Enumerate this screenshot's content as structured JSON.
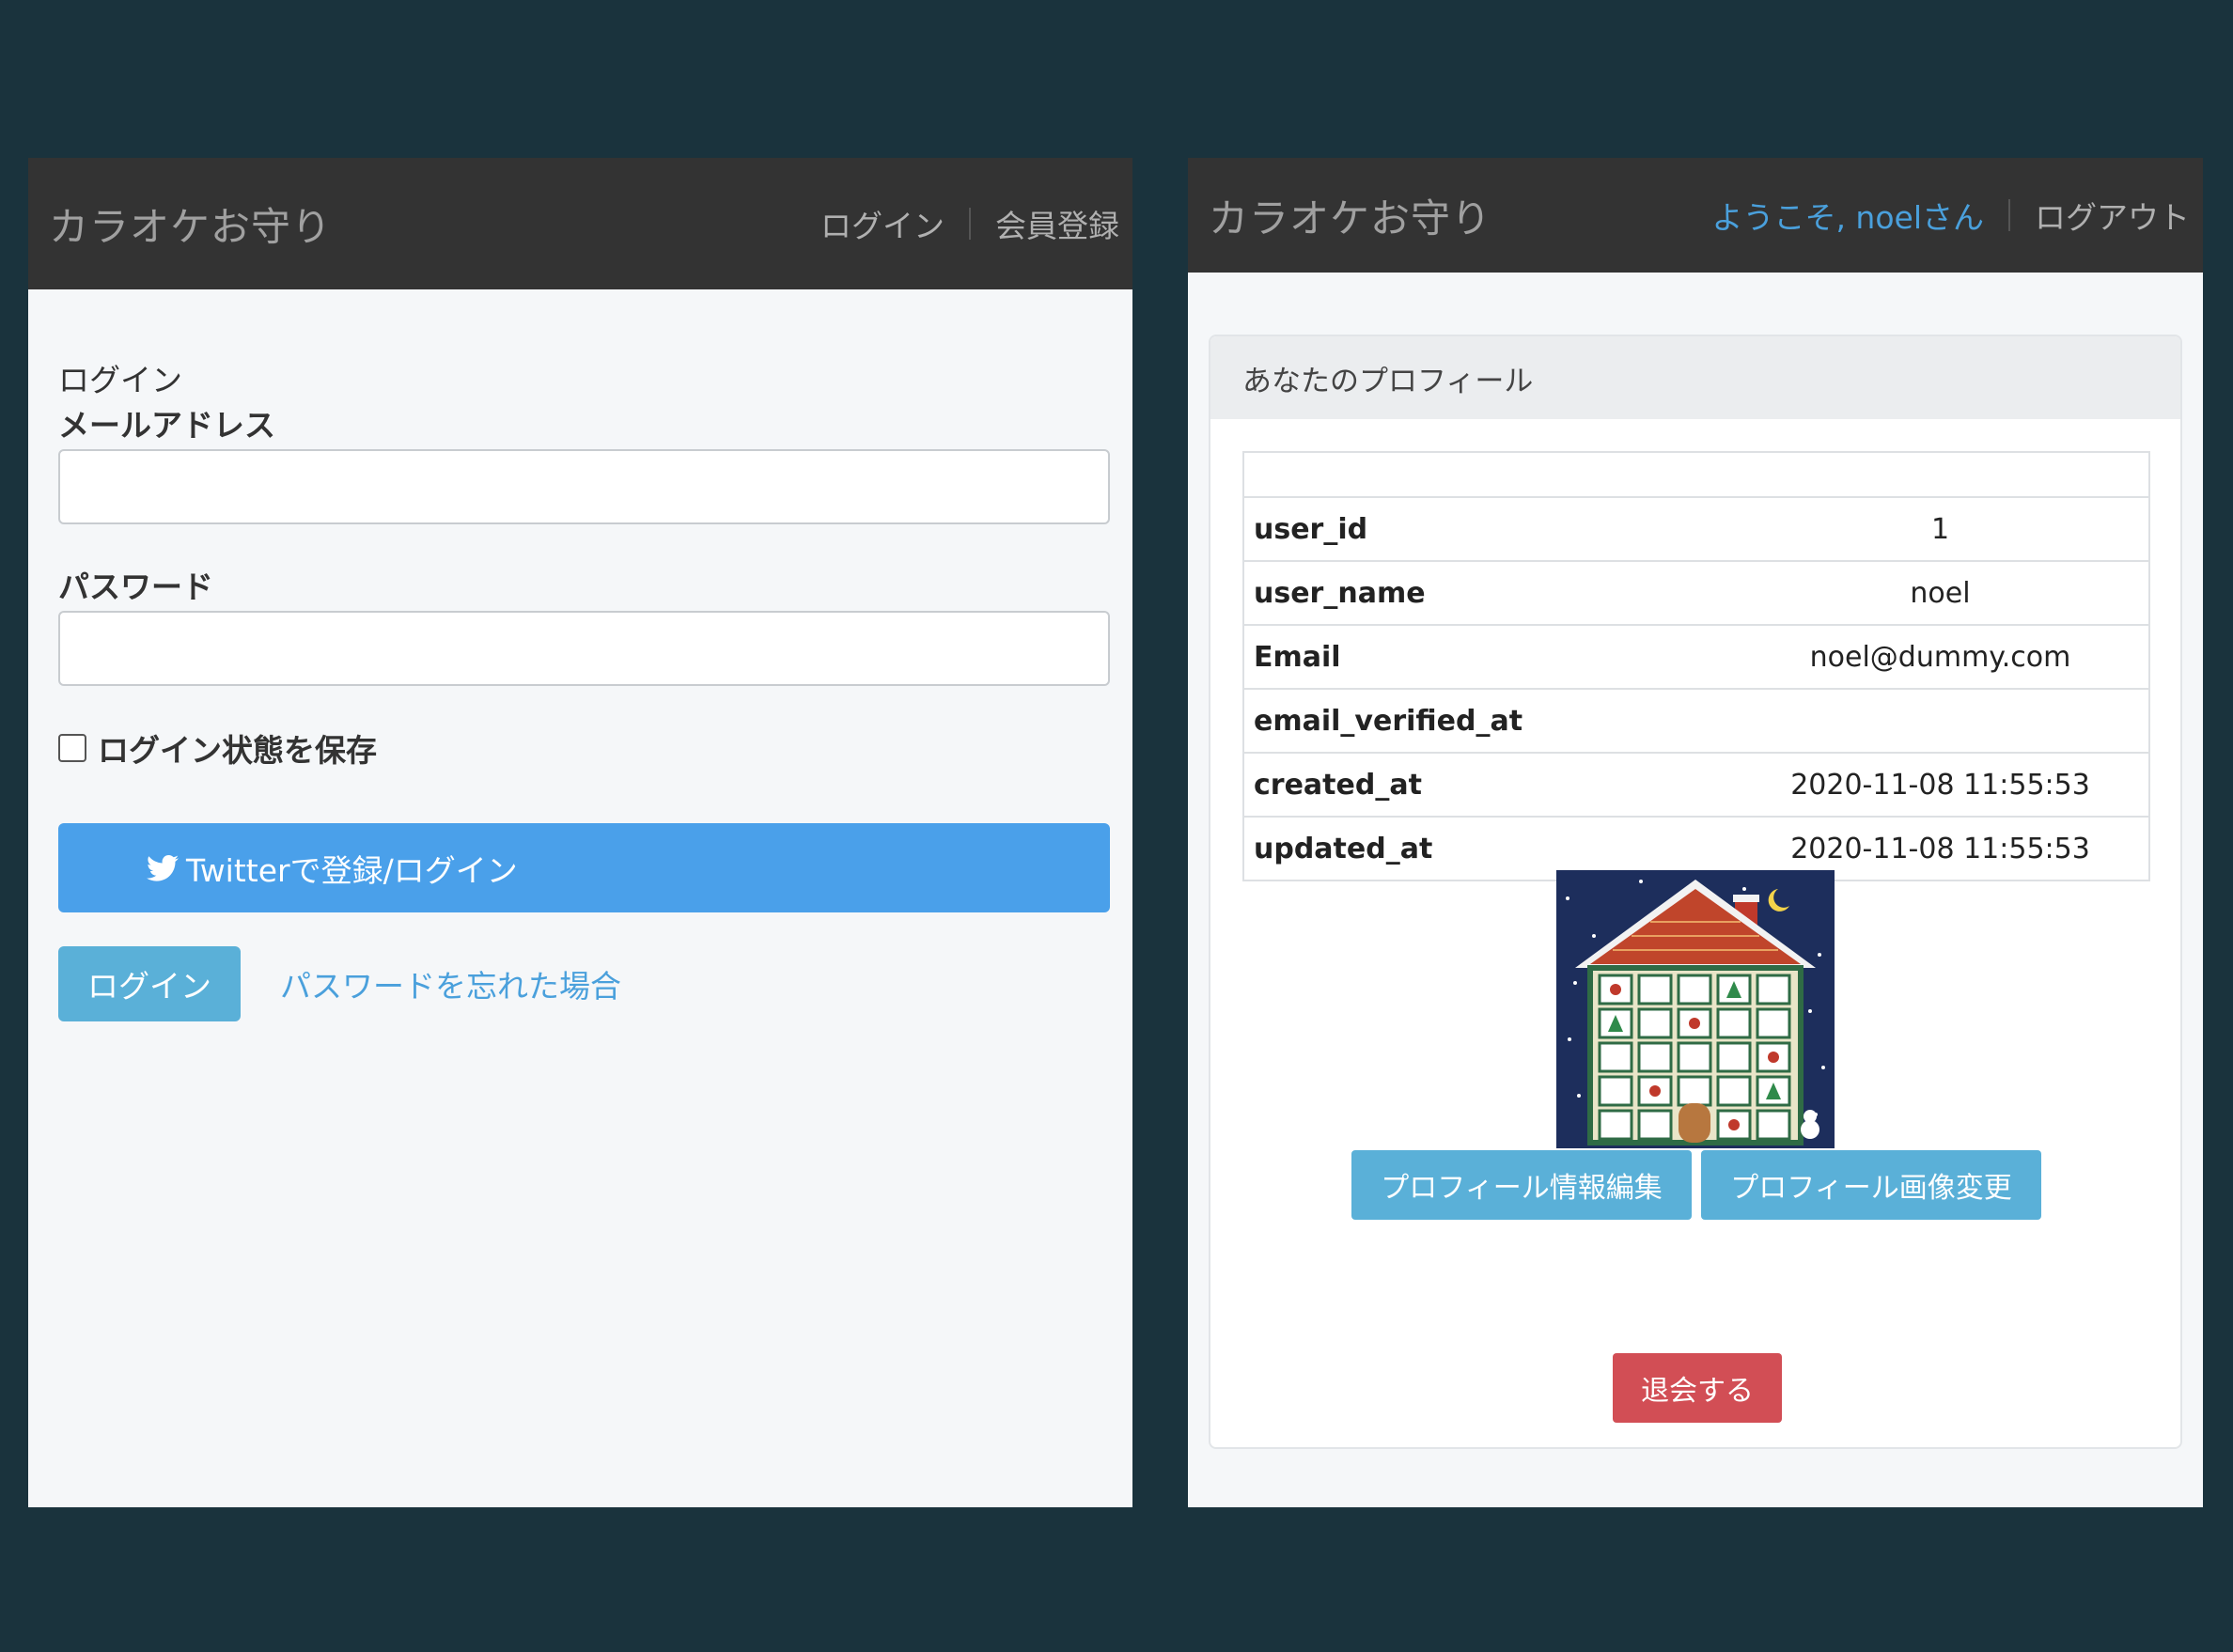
{
  "login_screen": {
    "navbar": {
      "brand": "カラオケお守り",
      "login_link": "ログイン",
      "register_link": "会員登録"
    },
    "form": {
      "heading": "ログイン",
      "email_label": "メールアドレス",
      "email_value": "",
      "password_label": "パスワード",
      "password_value": "",
      "remember_label": "ログイン状態を保存",
      "remember_checked": false,
      "twitter_button": "Twitterで登録/ログイン",
      "twitter_icon": "twitter-bird-icon",
      "login_button": "ログイン",
      "forgot_link": "パスワードを忘れた場合"
    }
  },
  "profile_screen": {
    "navbar": {
      "brand": "カラオケお守り",
      "welcome": "ようこそ, noelさん",
      "logout_link": "ログアウト"
    },
    "card": {
      "title": "あなたのプロフィール",
      "rows": [
        {
          "key": "user_id",
          "value": "1"
        },
        {
          "key": "user_name",
          "value": "noel"
        },
        {
          "key": "Email",
          "value": "noel@dummy.com"
        },
        {
          "key": "email_verified_at",
          "value": ""
        },
        {
          "key": "created_at",
          "value": "2020-11-08 11:55:53"
        },
        {
          "key": "updated_at",
          "value": "2020-11-08 11:55:53"
        }
      ],
      "avatar_description": "advent-calendar-house-image",
      "edit_profile_button": "プロフィール情報編集",
      "change_image_button": "プロフィール画像変更",
      "withdraw_button": "退会する"
    }
  },
  "colors": {
    "background": "#1a333d",
    "navbar": "#333333",
    "primary_button": "#5ab0d8",
    "twitter": "#4aa0ea",
    "danger": "#d24e55",
    "link": "#4aa0dc"
  }
}
